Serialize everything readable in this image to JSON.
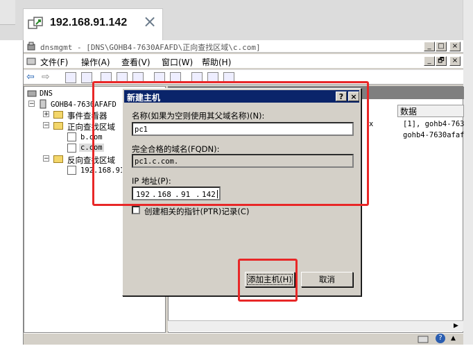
{
  "browser": {
    "tab_title": "192.168.91.142",
    "close_glyph": "×"
  },
  "mmc": {
    "title": "dnsmgmt - [DNS\\GOHB4-7630AFAFD\\正向查找区域\\c.com]",
    "window_buttons": [
      "_",
      "□",
      "×"
    ],
    "inner_buttons": [
      "_",
      "🗗",
      "×"
    ],
    "menu": [
      "文件(F)",
      "操作(A)",
      "查看(V)",
      "窗口(W)",
      "帮助(H)"
    ],
    "tree": {
      "root": "DNS",
      "server": "GOHB4-7630AFAFD",
      "event_viewer": "事件查看器",
      "forward_zones": "正向查找区域",
      "zone_b": "b.com",
      "zone_c": "c.com",
      "reverse_zones": "反向查找区域",
      "reverse_zone": "192.168.91"
    },
    "list": {
      "column_data": "数据",
      "row1_data": "[1], gohb4-763",
      "row2_data": "gohb4-7630afaf",
      "row1_partial": "x"
    }
  },
  "dialog": {
    "title": "新建主机",
    "help_button": "?",
    "close_button": "×",
    "name_label": "名称(如果为空则使用其父域名称)(N):",
    "name_value": "pc1",
    "fqdn_label": "完全合格的域名(FQDN):",
    "fqdn_value": "pc1.c.com.",
    "ip_label": "IP 地址(P):",
    "ip_octets": [
      "192",
      "168",
      "91",
      "142"
    ],
    "ptr_checkbox_label": "创建相关的指针(PTR)记录(C)",
    "ptr_checked": false,
    "add_host_button": "添加主机(H)",
    "cancel_button": "取消"
  },
  "colors": {
    "annotation_red": "#e82727",
    "dialog_title_bg": "#0a246a"
  }
}
